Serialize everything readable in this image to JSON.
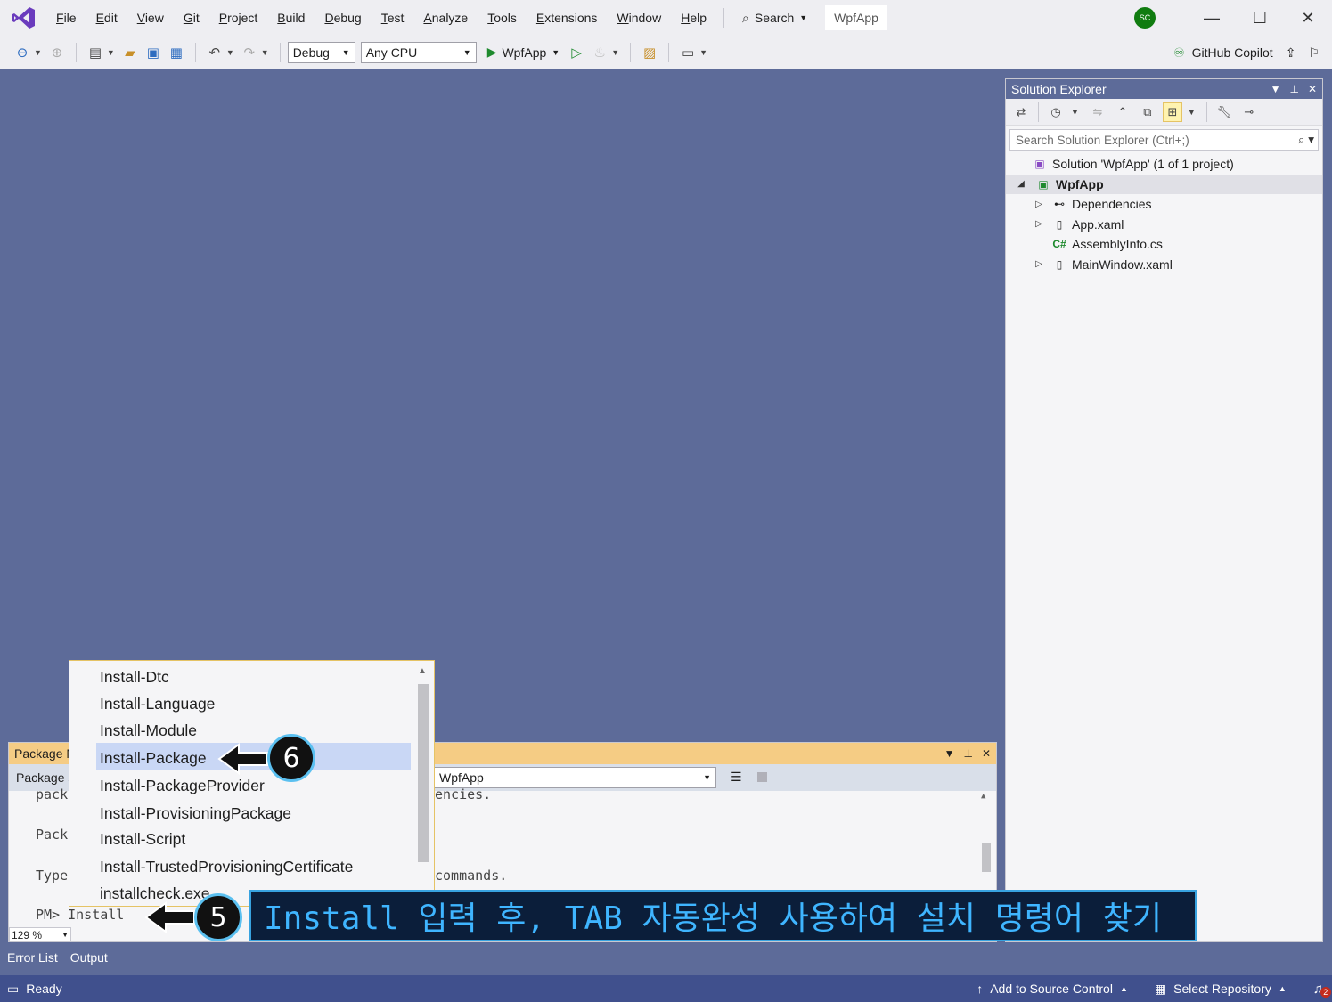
{
  "menu": {
    "items": [
      "File",
      "Edit",
      "View",
      "Git",
      "Project",
      "Build",
      "Debug",
      "Test",
      "Analyze",
      "Tools",
      "Extensions",
      "Window",
      "Help"
    ],
    "search_label": "Search",
    "solution_name": "WpfApp",
    "avatar_initials": "SC"
  },
  "toolbar": {
    "configuration": "Debug",
    "platform": "Any CPU",
    "run_target": "WpfApp",
    "copilot_label": "GitHub Copilot"
  },
  "solution_explorer": {
    "title": "Solution Explorer",
    "search_placeholder": "Search Solution Explorer (Ctrl+;)",
    "tree": [
      {
        "label": "Solution 'WpfApp' (1 of 1 project)",
        "icon": "solution-icon"
      },
      {
        "label": "WpfApp",
        "icon": "csharp-project-icon"
      },
      {
        "label": "Dependencies",
        "icon": "dependencies-icon"
      },
      {
        "label": "App.xaml",
        "icon": "xaml-file-icon"
      },
      {
        "label": "AssemblyInfo.cs",
        "icon": "csharp-file-icon"
      },
      {
        "label": "MainWindow.xaml",
        "icon": "xaml-file-icon"
      }
    ]
  },
  "pmc": {
    "title": "Package M",
    "source_label": "Package s",
    "default_project": "WpfApp",
    "lines": [
      "pack",
      "encies.",
      "Pack",
      "Type",
      "commands."
    ],
    "prompt": "PM> Install",
    "zoom": "129 %"
  },
  "autocomplete": {
    "items": [
      "Install-Dtc",
      "Install-Language",
      "Install-Module",
      "Install-Package",
      "Install-PackageProvider",
      "Install-ProvisioningPackage",
      "Install-Script",
      "Install-TrustedProvisioningCertificate",
      "installcheck.exe"
    ],
    "selected_index": 3
  },
  "bottom_tabs": [
    "Error List",
    "Output"
  ],
  "status": {
    "ready": "Ready",
    "add_source": "Add to Source Control",
    "select_repo": "Select Repository",
    "notifications": "2"
  },
  "annotations": {
    "step5": "5",
    "step6": "6",
    "caption": "Install 입력 후, TAB 자동완성 사용하여 설치 명령어 찾기"
  },
  "colors": {
    "accent": "#5d6b99",
    "caption_text": "#3fb5ff",
    "badge_ring": "#5bc0f0"
  }
}
